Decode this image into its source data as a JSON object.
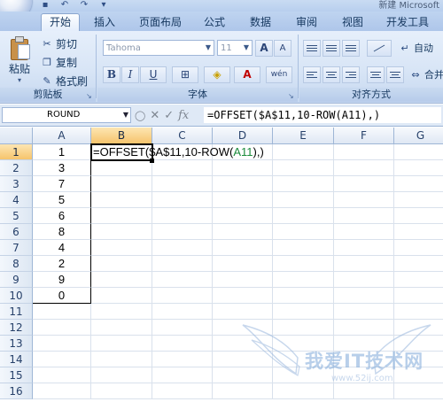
{
  "window": {
    "title": "新建 Microsoft"
  },
  "tabs": [
    "开始",
    "插入",
    "页面布局",
    "公式",
    "数据",
    "审阅",
    "视图",
    "开发工具"
  ],
  "active_tab": "开始",
  "clipboard": {
    "paste_label": "粘贴",
    "cut_label": "剪切",
    "copy_label": "复制",
    "format_painter_label": "格式刷",
    "group_label": "剪贴板"
  },
  "font": {
    "font_name": "Tahoma",
    "font_size": "11",
    "bold": "B",
    "italic": "I",
    "underline": "U",
    "grow_label": "A",
    "shrink_label": "A",
    "font_color_label": "A",
    "phonetic_label": "wén",
    "group_label": "字体"
  },
  "alignment": {
    "group_label": "对齐方式",
    "wrap_label": "自动",
    "merge_label": "合并"
  },
  "formula_bar": {
    "name_box": "ROUND",
    "formula": "=OFFSET($A$11,10-ROW(A11),)",
    "fx_label": "fx"
  },
  "sheet": {
    "columns": [
      "A",
      "B",
      "C",
      "D",
      "E",
      "F",
      "G"
    ],
    "rows": [
      "1",
      "2",
      "3",
      "4",
      "5",
      "6",
      "7",
      "8",
      "9",
      "10",
      "11",
      "12",
      "13",
      "14",
      "15",
      "16"
    ],
    "active_cell": "B1",
    "column_a_values": [
      "1",
      "3",
      "7",
      "5",
      "6",
      "8",
      "4",
      "2",
      "9",
      "0"
    ],
    "b1_formula": {
      "part1": "=OFFSET($A$11,10-ROW(",
      "part2": "A11",
      "part3": "),)"
    },
    "colors": {
      "ref_highlight": "#1a8a3a",
      "header_selected": "#f6c46c",
      "grid_line": "#d9e1ec"
    }
  },
  "watermark": {
    "title": "我爱IT技术网",
    "url": "www.52ij.com"
  }
}
